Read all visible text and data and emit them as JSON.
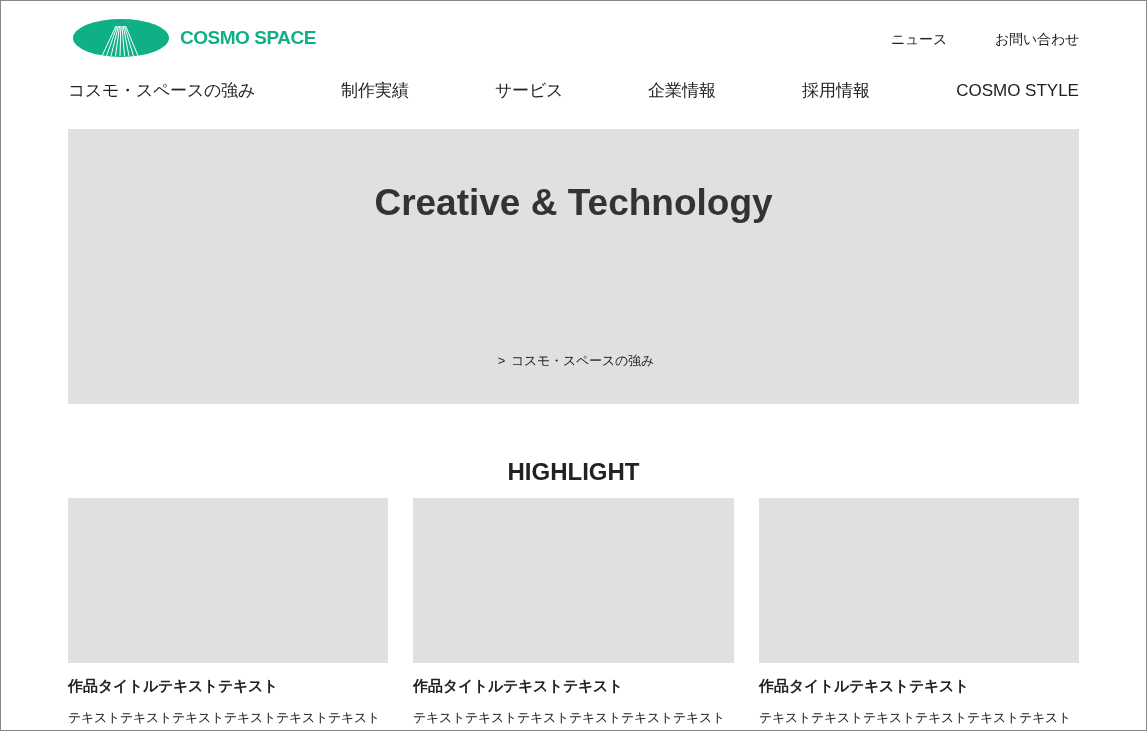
{
  "header": {
    "logo_text": "COSMO SPACE",
    "utility_links": [
      "ニュース",
      "お問い合わせ"
    ]
  },
  "nav": [
    "コスモ・スペースの強み",
    "制作実績",
    "サービス",
    "企業情報",
    "採用情報",
    "COSMO STYLE"
  ],
  "hero": {
    "title": "Creative & Technology",
    "link_arrow": ">",
    "link": "コスモ・スペースの強み"
  },
  "highlight": {
    "heading": "HIGHLIGHT",
    "cards": [
      {
        "kind": "picture",
        "title": "作品タイトルテキストテキスト",
        "text": "テキストテキストテキストテキストテキストテキスト"
      },
      {
        "kind": "picture",
        "title": "作品タイトルテキストテキスト",
        "text": "テキストテキストテキストテキストテキストテキスト"
      },
      {
        "kind": "picture",
        "title": "作品タイトルテキストテキスト",
        "text": "テキストテキストテキストテキストテキストテキスト"
      }
    ]
  }
}
